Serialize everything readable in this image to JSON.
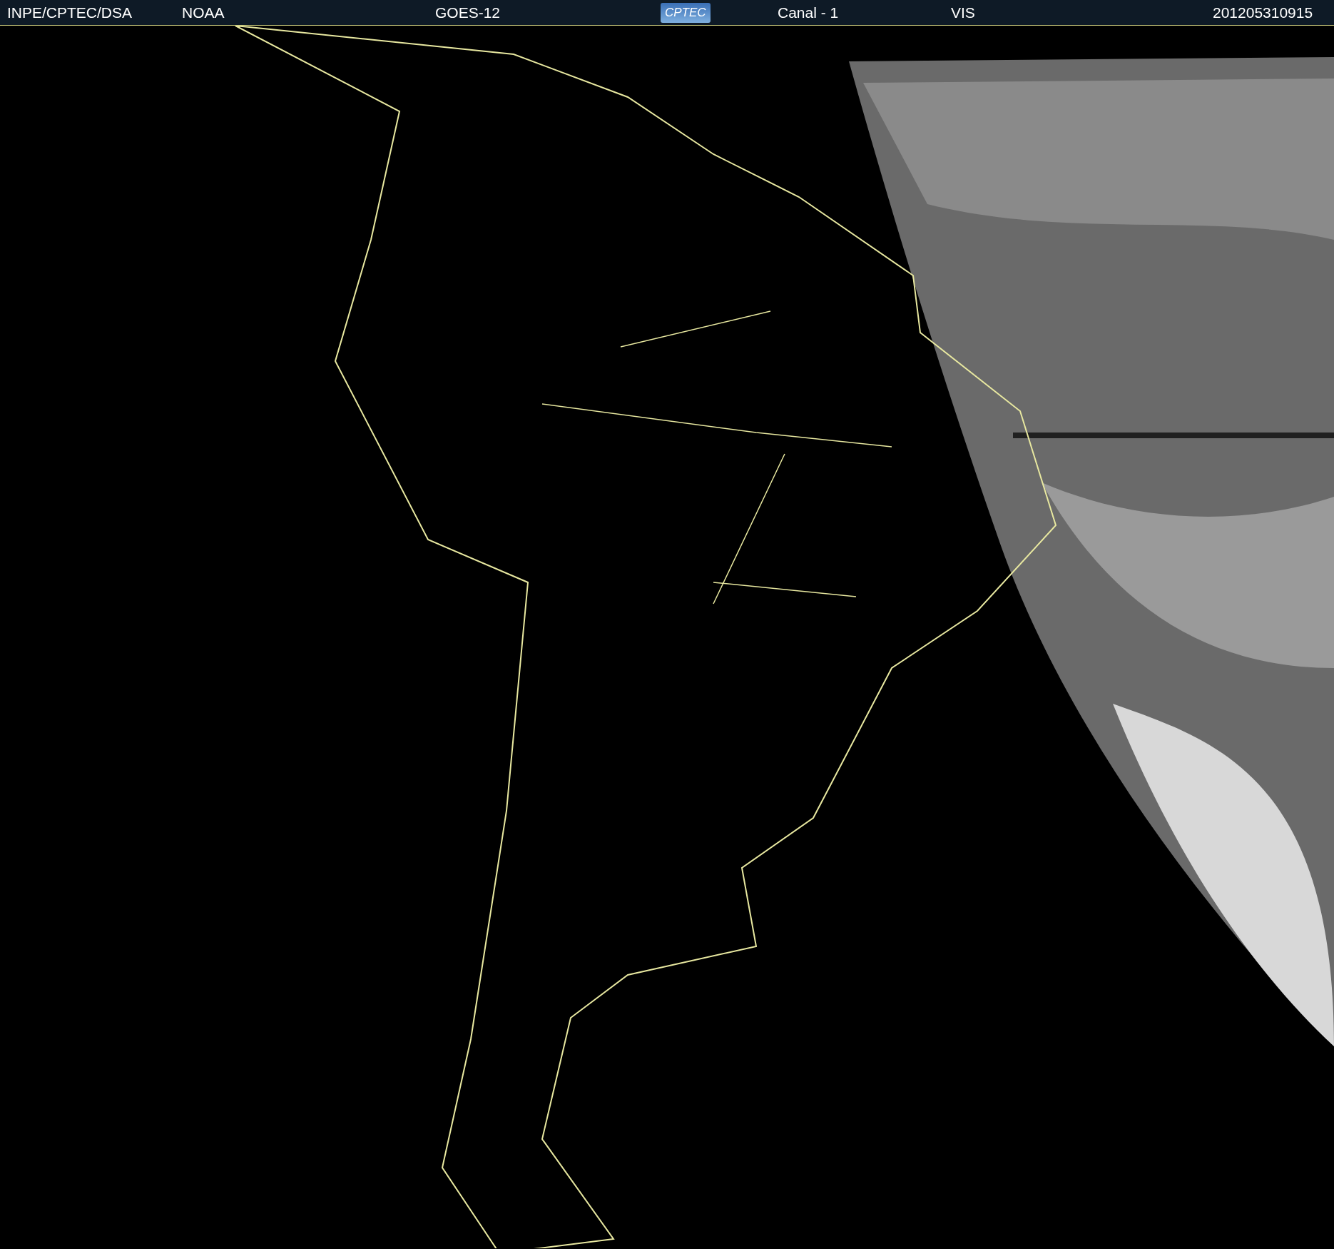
{
  "header": {
    "items": [
      {
        "kind": "text",
        "text": "INPE/CPTEC/DSA"
      },
      {
        "kind": "text",
        "text": "NOAA"
      },
      {
        "kind": "text",
        "text": "GOES-12"
      },
      {
        "kind": "logo",
        "text": "CPTEC"
      },
      {
        "kind": "text",
        "text": "Canal - 1"
      },
      {
        "kind": "text",
        "text": "VIS"
      },
      {
        "kind": "text",
        "text": "201205310915"
      }
    ]
  }
}
